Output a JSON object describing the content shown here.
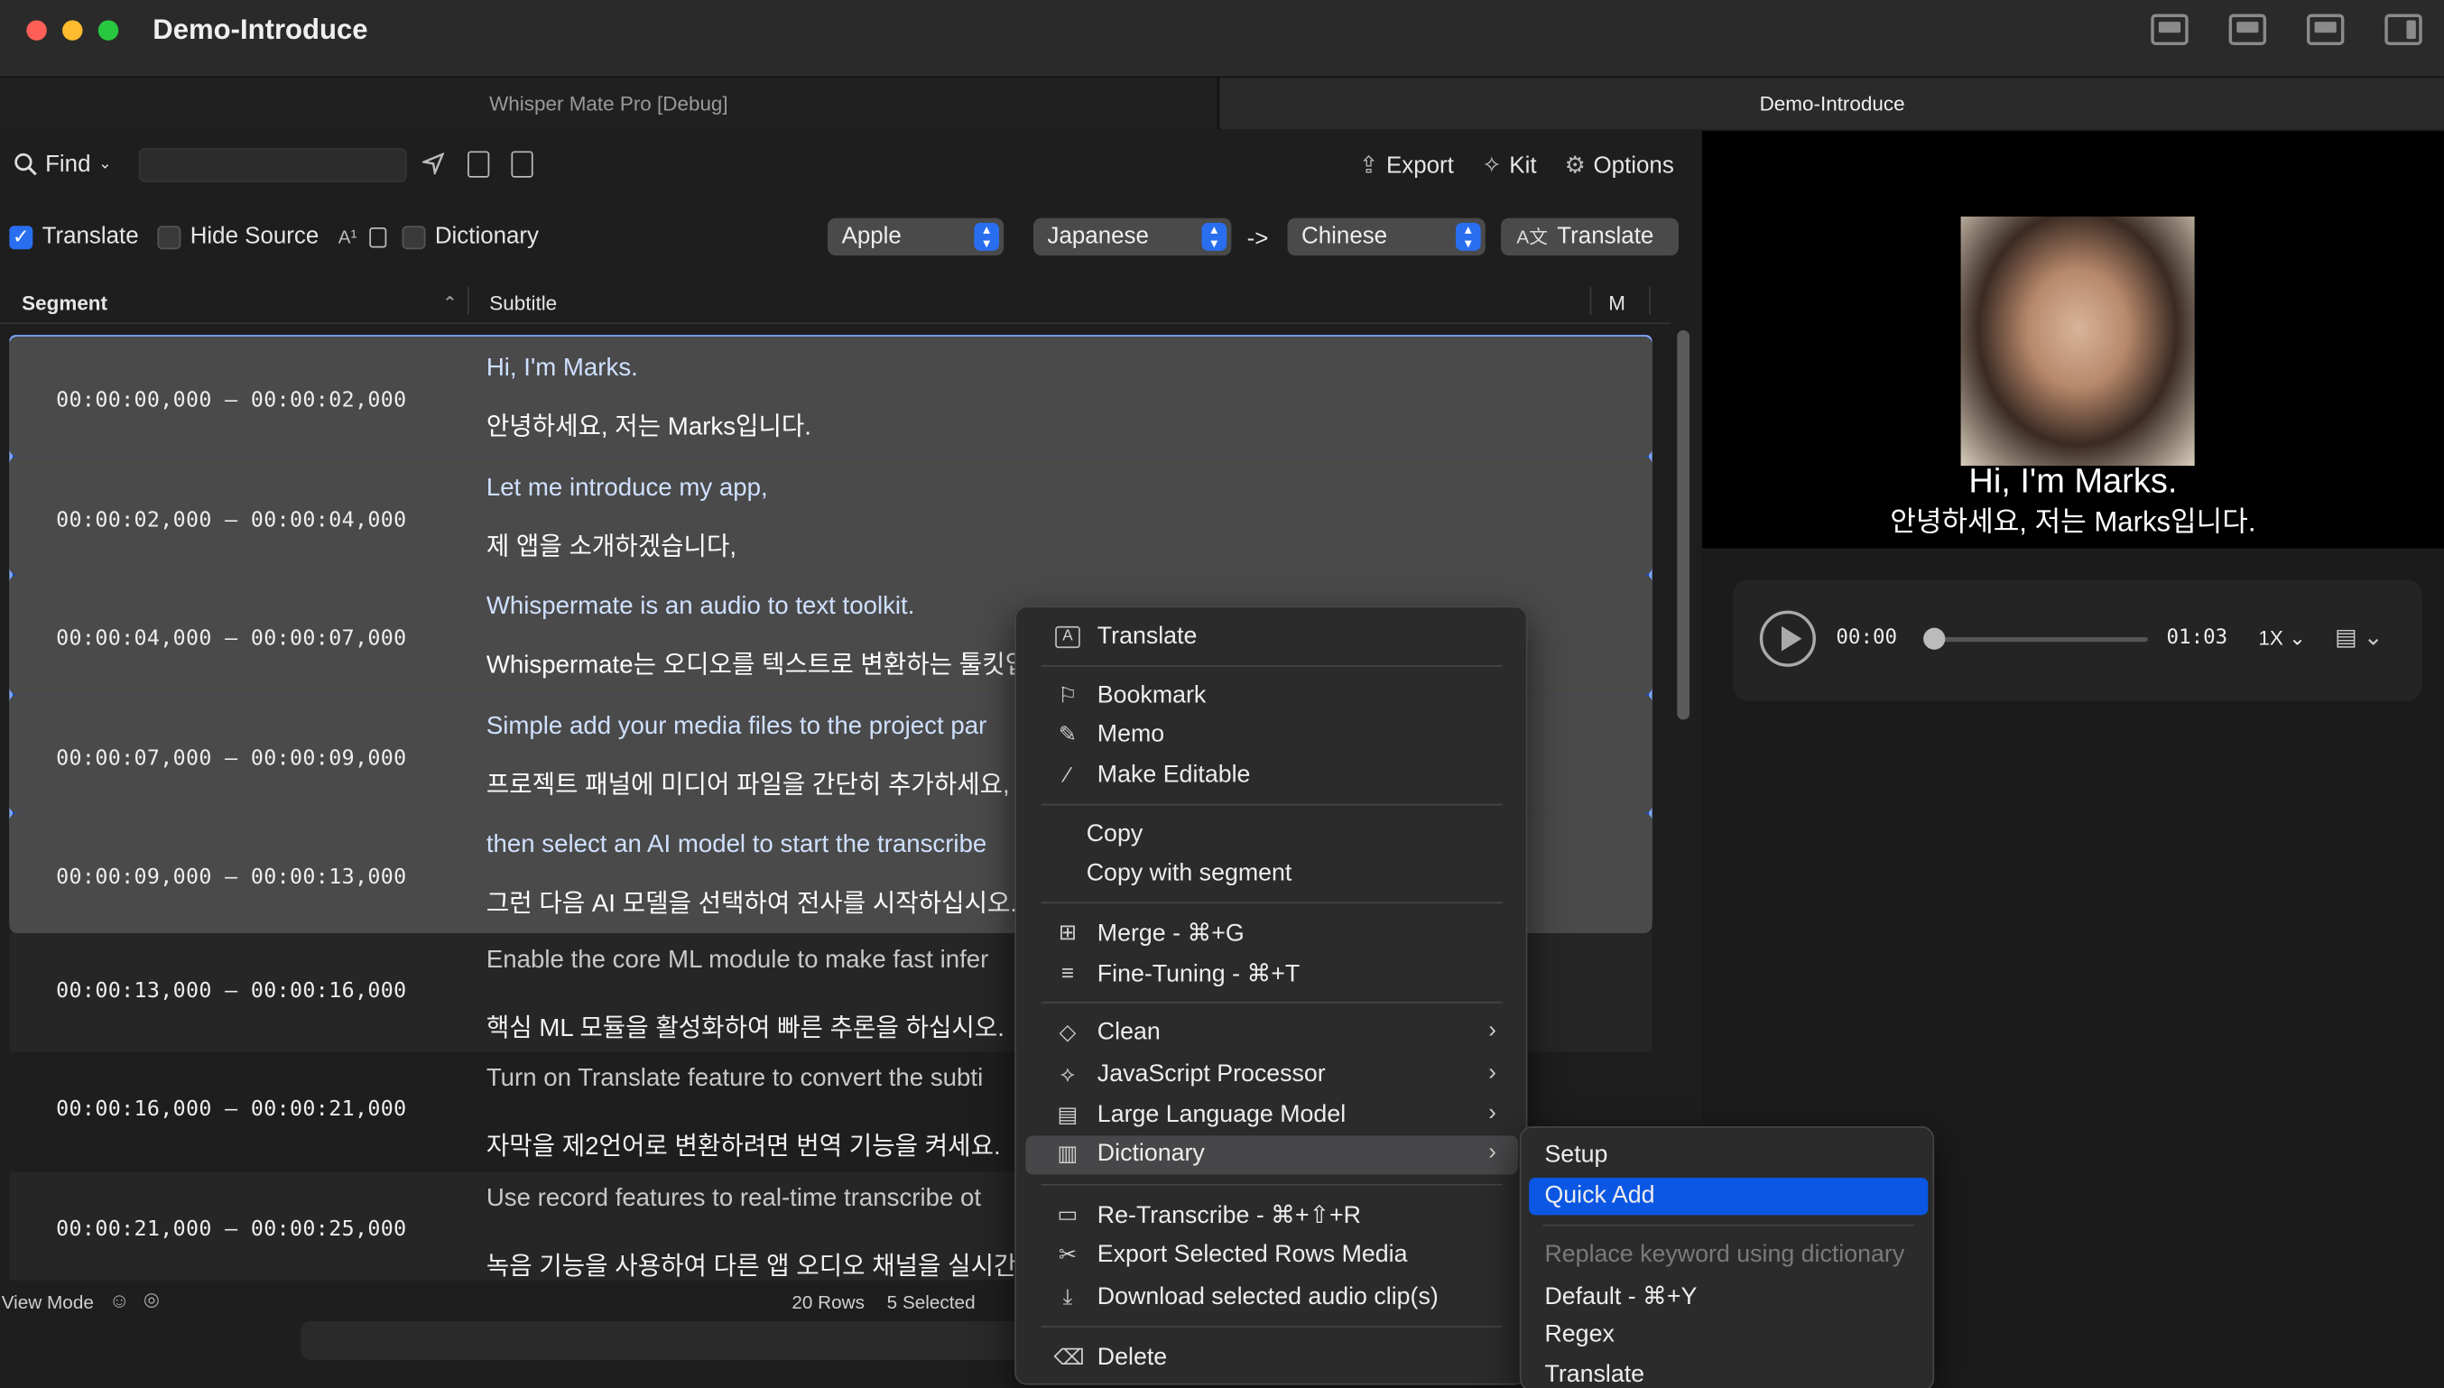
{
  "window": {
    "title": "Demo-Introduce",
    "tabs": [
      "Whisper Mate Pro [Debug]",
      "Demo-Introduce"
    ]
  },
  "toolbar": {
    "find_label": "Find",
    "find_placeholder": "",
    "export_label": "Export",
    "kit_label": "Kit",
    "options_label": "Options"
  },
  "options": {
    "translate_label": "Translate",
    "translate_checked": true,
    "hide_source_label": "Hide Source",
    "hide_source_checked": false,
    "dictionary_label": "Dictionary",
    "dictionary_checked": false,
    "engine": "Apple",
    "source_lang": "Japanese",
    "arrow": "->",
    "target_lang": "Chinese",
    "translate_button": "Translate"
  },
  "table": {
    "headers": [
      "Segment",
      "Subtitle",
      "M"
    ],
    "rows": [
      {
        "time": "00:00:00,000 – 00:00:02,000",
        "src": "Hi, I'm Marks.",
        "dst": "안녕하세요, 저는 Marks입니다.",
        "selected": true
      },
      {
        "time": "00:00:02,000 – 00:00:04,000",
        "src": "Let me introduce my app,",
        "dst": "제 앱을 소개하겠습니다,",
        "selected": true
      },
      {
        "time": "00:00:04,000 – 00:00:07,000",
        "src": "Whispermate is an audio to text toolkit.",
        "dst": "Whispermate는 오디오를 텍스트로 변환하는 툴킷입",
        "selected": true
      },
      {
        "time": "00:00:07,000 – 00:00:09,000",
        "src": "Simple add your media files to the project par",
        "dst": "프로젝트 패널에 미디어 파일을 간단히 추가하세요,",
        "selected": true
      },
      {
        "time": "00:00:09,000 – 00:00:13,000",
        "src": "then select an AI model to start the transcribe",
        "dst": "그런 다음 AI 모델을 선택하여 전사를 시작하십시오.",
        "selected": true
      },
      {
        "time": "00:00:13,000 – 00:00:16,000",
        "src": "Enable the core ML module to make fast infer",
        "dst": "핵심 ML 모듈을 활성화하여 빠른 추론을 하십시오.",
        "selected": false
      },
      {
        "time": "00:00:16,000 – 00:00:21,000",
        "src": "Turn on Translate feature to convert the subti",
        "dst": "자막을 제2언어로 변환하려면 번역 기능을 켜세요.",
        "selected": false
      },
      {
        "time": "00:00:21,000 – 00:00:25,000",
        "src": "Use record features to real-time transcribe ot",
        "dst": "녹음 기능을 사용하여 다른 앱 오디오 채널을 실시간으",
        "selected": false
      }
    ]
  },
  "status": {
    "view_mode": "View Mode",
    "rows": "20 Rows",
    "selected": "5 Selected"
  },
  "preview": {
    "caption_en": "Hi, I'm Marks.",
    "caption_ko": "안녕하세요, 저는 Marks입니다.",
    "time_current": "00:00",
    "time_total": "01:03",
    "speed": "1X",
    "progress": 0
  },
  "context_menu": {
    "items": [
      {
        "label": "Translate",
        "icon": "translate-icon",
        "glyph": "A"
      },
      {
        "label": "Bookmark",
        "icon": "bookmark-icon",
        "glyph": "❐"
      },
      {
        "label": "Memo",
        "icon": "pencil-icon",
        "glyph": "✎"
      },
      {
        "label": "Make Editable",
        "icon": "slash-icon",
        "glyph": "⁄"
      },
      {
        "label": "Copy",
        "icon": "",
        "glyph": ""
      },
      {
        "label": "Copy with segment",
        "icon": "",
        "glyph": ""
      },
      {
        "label": "Merge - ⌘+G",
        "icon": "merge-icon",
        "glyph": "⊞"
      },
      {
        "label": "Fine-Tuning - ⌘+T",
        "icon": "sliders-icon",
        "glyph": "≡"
      },
      {
        "label": "Clean",
        "icon": "eraser-icon",
        "glyph": "◇"
      },
      {
        "label": "JavaScript Processor",
        "icon": "script-icon",
        "glyph": "⟡"
      },
      {
        "label": "Large Language Model",
        "icon": "chat-icon",
        "glyph": "▤"
      },
      {
        "label": "Dictionary",
        "icon": "book-icon",
        "glyph": "▥"
      },
      {
        "label": "Re-Transcribe - ⌘+⇧+R",
        "icon": "film-icon",
        "glyph": "▭"
      },
      {
        "label": "Export Selected Rows Media",
        "icon": "scissors-icon",
        "glyph": "✂"
      },
      {
        "label": "Download selected audio clip(s)",
        "icon": "download-icon",
        "glyph": "⤓"
      },
      {
        "label": "Delete",
        "icon": "trash-icon",
        "glyph": "🗑"
      }
    ]
  },
  "submenu": {
    "items": [
      "Setup",
      "Quick Add",
      "Replace keyword using dictionary",
      "Default - ⌘+Y",
      "Regex",
      "Translate"
    ]
  }
}
